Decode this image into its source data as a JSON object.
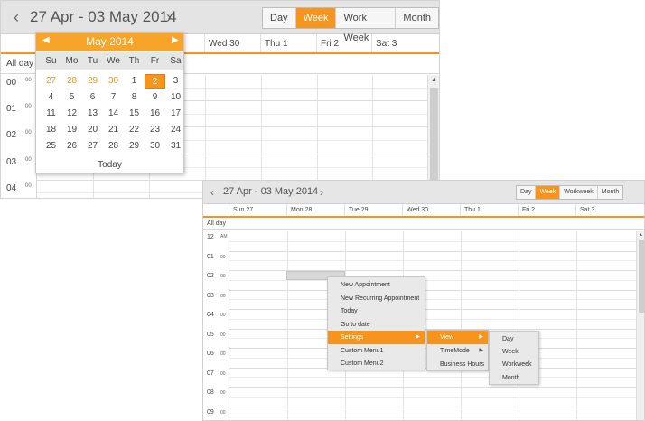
{
  "scheduler_main": {
    "date_range": "27 Apr - 03 May 2014",
    "prev_icon": "chevron-left-icon",
    "next_icon": "chevron-right-icon",
    "views": [
      "Day",
      "Week",
      "Work Week",
      "Month"
    ],
    "active_view": "Week",
    "day_headers": [
      "",
      "",
      "",
      "",
      "Wed 30",
      "Thu 1",
      "Fri 2",
      "Sat 3"
    ],
    "allday_label": "All day",
    "hours": [
      "00",
      "01",
      "02",
      "03",
      "04"
    ],
    "minute_label": "00"
  },
  "calendar_popup": {
    "title": "May 2014",
    "prev_icon": "triangle-left-icon",
    "next_icon": "triangle-right-icon",
    "weekdays": [
      "Su",
      "Mo",
      "Tu",
      "We",
      "Th",
      "Fr",
      "Sa"
    ],
    "weeks": [
      [
        "27",
        "28",
        "29",
        "30",
        "1",
        "2",
        "3"
      ],
      [
        "4",
        "5",
        "6",
        "7",
        "8",
        "9",
        "10"
      ],
      [
        "11",
        "12",
        "13",
        "14",
        "15",
        "16",
        "17"
      ],
      [
        "18",
        "19",
        "20",
        "21",
        "22",
        "23",
        "24"
      ],
      [
        "25",
        "26",
        "27",
        "28",
        "29",
        "30",
        "31"
      ]
    ],
    "other_month_days": [
      "27",
      "28",
      "29",
      "30"
    ],
    "selected_day": "2",
    "today_label": "Today"
  },
  "scheduler_context": {
    "date_range": "27 Apr - 03 May 2014",
    "views": [
      "Day",
      "Week",
      "Workweek",
      "Month"
    ],
    "active_view": "Week",
    "day_headers": [
      "Sun 27",
      "Mon 28",
      "Tue 29",
      "Wed 30",
      "Thu 1",
      "Fri 2",
      "Sat 3"
    ],
    "allday_label": "All day",
    "first_hour": "12",
    "first_hour_suffix": "AM",
    "hours": [
      "01",
      "02",
      "03",
      "04",
      "05",
      "06",
      "07",
      "08",
      "09"
    ],
    "minute_label": "00"
  },
  "context_menu": {
    "items": [
      "New Appointment",
      "New Recurring Appointment",
      "Today",
      "Go to date",
      "Settings",
      "Custom Menu1",
      "Custom Menu2"
    ],
    "highlighted": "Settings"
  },
  "settings_submenu": {
    "items": [
      "View",
      "TimeMode",
      "Business Hours"
    ],
    "highlighted": "View"
  },
  "view_submenu": {
    "items": [
      "Day",
      "Week",
      "Workweek",
      "Month"
    ]
  },
  "colors": {
    "accent": "#f7941d",
    "header_bg": "#e4e4e4",
    "menu_bg": "#e9e9e9"
  }
}
